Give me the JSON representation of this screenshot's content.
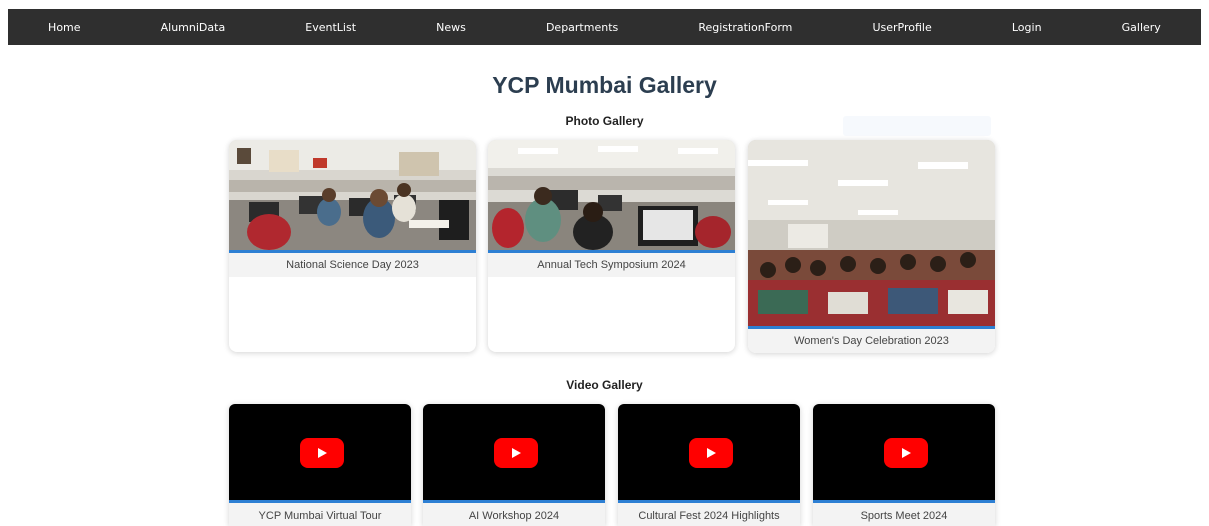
{
  "nav": {
    "items": [
      "Home",
      "AlumniData",
      "EventList",
      "News",
      "Departments",
      "RegistrationForm",
      "UserProfile",
      "Login",
      "Gallery"
    ]
  },
  "page": {
    "title": "YCP Mumbai Gallery"
  },
  "photo_gallery": {
    "heading": "Photo Gallery",
    "items": [
      {
        "caption": "National Science Day 2023"
      },
      {
        "caption": "Annual Tech Symposium 2024"
      },
      {
        "caption": "Women's Day Celebration 2023"
      }
    ]
  },
  "video_gallery": {
    "heading": "Video Gallery",
    "items": [
      {
        "caption": "YCP Mumbai Virtual Tour"
      },
      {
        "caption": "AI Workshop 2024"
      },
      {
        "caption": "Cultural Fest 2024 Highlights"
      },
      {
        "caption": "Sports Meet 2024"
      }
    ]
  },
  "colors": {
    "nav_bg": "#2f2f2f",
    "title": "#2c3e50",
    "accent_border": "#2d7fd3",
    "play_button": "#ff0000"
  },
  "icons": {
    "video": "youtube-play-icon"
  }
}
